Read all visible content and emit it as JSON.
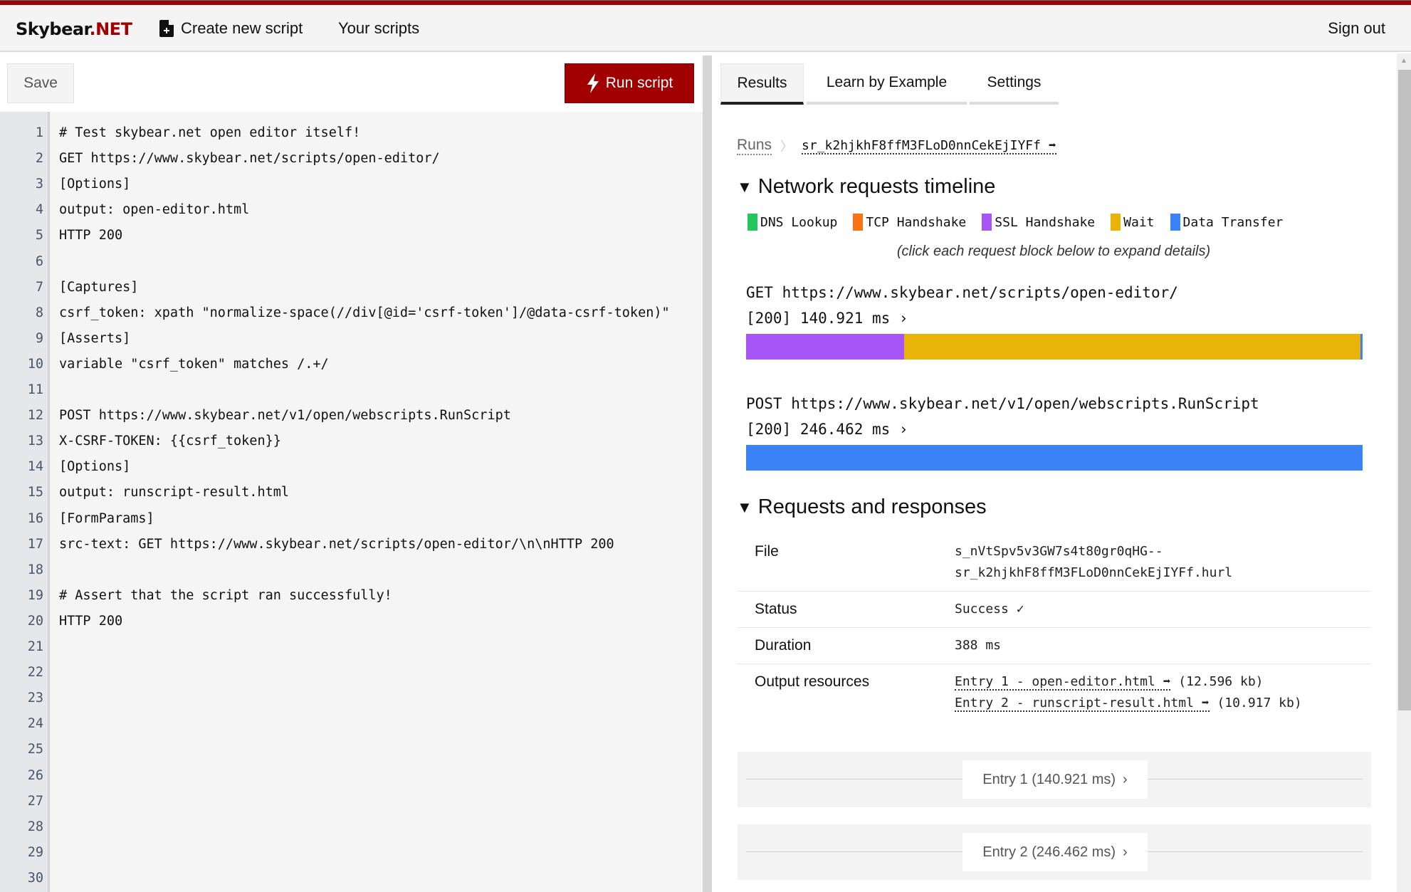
{
  "header": {
    "logo_brand": "Skybear",
    "logo_suffix": ".NET",
    "nav": [
      {
        "label": "Create new script",
        "icon": "file-plus-icon"
      },
      {
        "label": "Your scripts"
      }
    ],
    "sign_out": "Sign out"
  },
  "editor": {
    "save_label": "Save",
    "run_label": "Run script",
    "run_icon": "bolt-icon",
    "lines": [
      {
        "n": "1",
        "text": "# Test skybear.net open editor itself!"
      },
      {
        "n": "2",
        "text": "GET https://www.skybear.net/scripts/open-editor/"
      },
      {
        "n": "3",
        "text": "[Options]"
      },
      {
        "n": "4",
        "text": "output: open-editor.html"
      },
      {
        "n": "5",
        "text": "HTTP 200"
      },
      {
        "n": "6",
        "text": ""
      },
      {
        "n": "7",
        "text": "[Captures]"
      },
      {
        "n": "8",
        "text": "csrf_token: xpath \"normalize-space(//div[@id='csrf-token']/@data-csrf-token)\""
      },
      {
        "n": "9",
        "text": "[Asserts]"
      },
      {
        "n": "10",
        "text": "variable \"csrf_token\" matches /.+/"
      },
      {
        "n": "11",
        "text": ""
      },
      {
        "n": "12",
        "text": "POST https://www.skybear.net/v1/open/webscripts.RunScript"
      },
      {
        "n": "13",
        "text": "X-CSRF-TOKEN: {{csrf_token}}"
      },
      {
        "n": "14",
        "text": "[Options]"
      },
      {
        "n": "15",
        "text": "output: runscript-result.html"
      },
      {
        "n": "16",
        "text": "[FormParams]"
      },
      {
        "n": "17",
        "text": "src-text: GET https://www.skybear.net/scripts/open-editor/\\n\\nHTTP 200"
      },
      {
        "n": "18",
        "text": ""
      },
      {
        "n": "19",
        "text": "# Assert that the script ran successfully!"
      },
      {
        "n": "20",
        "text": "HTTP 200"
      },
      {
        "n": "21",
        "text": ""
      },
      {
        "n": "22",
        "text": ""
      },
      {
        "n": "23",
        "text": ""
      },
      {
        "n": "24",
        "text": ""
      },
      {
        "n": "25",
        "text": ""
      },
      {
        "n": "26",
        "text": ""
      },
      {
        "n": "27",
        "text": ""
      },
      {
        "n": "28",
        "text": ""
      },
      {
        "n": "29",
        "text": ""
      },
      {
        "n": "30",
        "text": ""
      }
    ]
  },
  "results": {
    "tabs": [
      {
        "label": "Results",
        "active": true
      },
      {
        "label": "Learn by Example",
        "active": false
      },
      {
        "label": "Settings",
        "active": false
      }
    ],
    "breadcrumb": {
      "root": "Runs",
      "separator": "〉",
      "run_id": "sr_k2hjkhF8ffM3FLoD0nnCekEjIYFf",
      "arrow": "➡"
    },
    "timeline": {
      "title": "Network requests timeline",
      "toggle": "▼",
      "legend": [
        {
          "label": "DNS Lookup",
          "color": "#22c55e"
        },
        {
          "label": "TCP Handshake",
          "color": "#f97316"
        },
        {
          "label": "SSL Handshake",
          "color": "#a855f7"
        },
        {
          "label": "Wait",
          "color": "#eab308"
        },
        {
          "label": "Data Transfer",
          "color": "#3b82f6"
        }
      ],
      "hint": "(click each request block below to expand details)",
      "requests": [
        {
          "url": "GET https://www.skybear.net/scripts/open-editor/",
          "meta": "[200] 140.921 ms ›",
          "segments": [
            {
              "phase": "SSL Handshake",
              "fraction": 0.256,
              "color": "#a855f7"
            },
            {
              "phase": "Wait",
              "fraction": 0.741,
              "color": "#eab308"
            },
            {
              "phase": "Data Transfer",
              "fraction": 0.003,
              "color": "#3b82f6"
            }
          ]
        },
        {
          "url": "POST https://www.skybear.net/v1/open/webscripts.RunScript",
          "meta": "[200] 246.462 ms ›",
          "segments": [
            {
              "phase": "Data Transfer",
              "fraction": 1.0,
              "color": "#3b82f6"
            }
          ]
        }
      ]
    },
    "requests_responses": {
      "title": "Requests and responses",
      "toggle": "▼",
      "file_label": "File",
      "file_line1": "s_nVtSpv5v3GW7s4t80gr0qHG--",
      "file_line2": "sr_k2hjkhF8ffM3FLoD0nnCekEjIYFf.hurl",
      "status_label": "Status",
      "status_value": "Success ✓",
      "duration_label": "Duration",
      "duration_value": "388 ms",
      "output_label": "Output resources",
      "outputs": [
        {
          "link": "Entry 1 - open-editor.html ➡",
          "size": "(12.596 kb)"
        },
        {
          "link": "Entry 2 - runscript-result.html ➡",
          "size": "(10.917 kb)"
        }
      ]
    },
    "entries": [
      {
        "label": "Entry 1 (140.921 ms)",
        "chevron": "›"
      },
      {
        "label": "Entry 2 (246.462 ms)",
        "chevron": "›"
      }
    ]
  }
}
